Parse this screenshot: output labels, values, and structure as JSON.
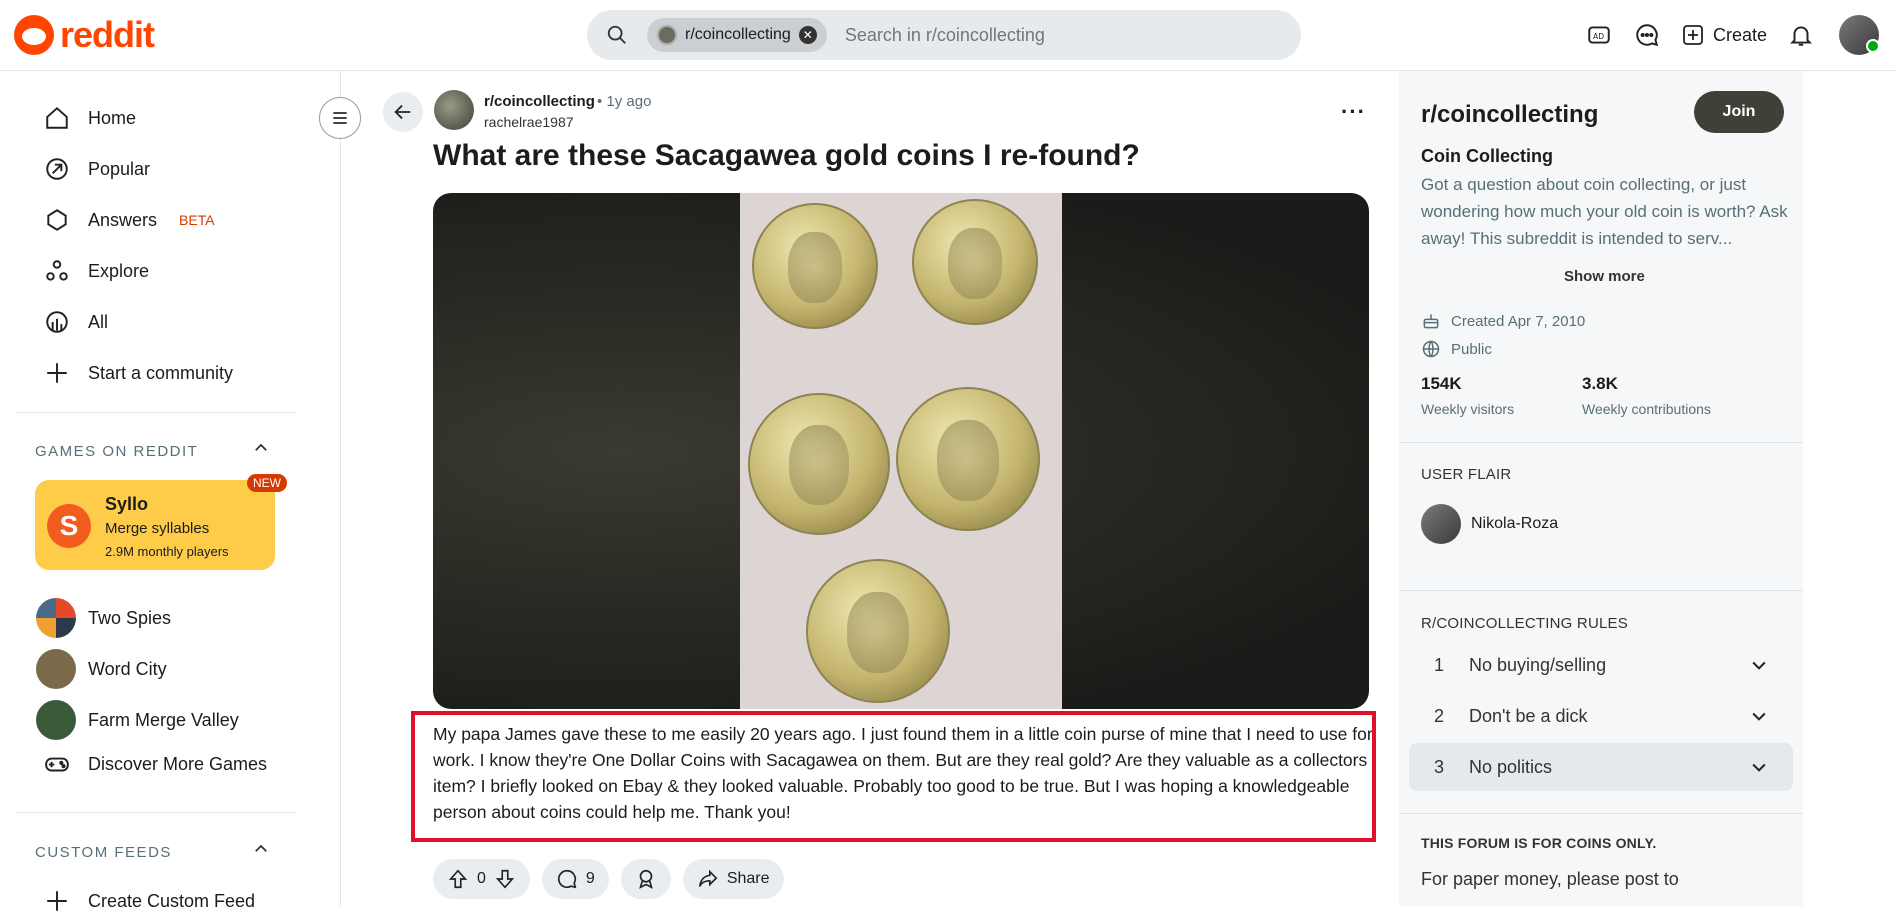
{
  "header": {
    "logo_text": "reddit",
    "search_chip": "r/coincollecting",
    "search_placeholder": "Search in r/coincollecting",
    "create_label": "Create"
  },
  "leftnav": {
    "items": [
      {
        "label": "Home",
        "icon": "home-icon"
      },
      {
        "label": "Popular",
        "icon": "popular-icon"
      },
      {
        "label": "Answers",
        "badge": "BETA",
        "icon": "answers-icon"
      },
      {
        "label": "Explore",
        "icon": "explore-icon"
      },
      {
        "label": "All",
        "icon": "all-icon"
      },
      {
        "label": "Start a community",
        "icon": "plus-icon"
      }
    ],
    "games_title": "GAMES ON REDDIT",
    "featured_game": {
      "name": "Syllo",
      "subtitle": "Merge syllables",
      "players": "2.9M monthly players",
      "badge": "NEW"
    },
    "games": [
      "Two Spies",
      "Word City",
      "Farm Merge Valley",
      "Discover More Games"
    ],
    "custom_feeds_title": "CUSTOM FEEDS",
    "create_custom_feed": "Create Custom Feed"
  },
  "post": {
    "subreddit": "r/coincollecting",
    "time": "• 1y ago",
    "author": "rachelrae1987",
    "title": "What are these Sacagawea gold coins I re-found?",
    "body": "My papa James gave these to me easily 20 years ago. I just found them in a little coin purse of mine that I need to use for work. I know they're One Dollar Coins with Sacagawea on them. But are they real gold? Are they valuable as a collectors item? I briefly looked on Ebay & they looked valuable. Probably too good to be true. But I was hoping a knowledgeable person about coins could help me. Thank you!",
    "votes": "0",
    "comments": "9",
    "share_label": "Share"
  },
  "sidebar": {
    "title": "r/coincollecting",
    "join_label": "Join",
    "subtitle": "Coin Collecting",
    "description": "Got a question about coin collecting, or just wondering how much your old coin is worth? Ask away! This subreddit is intended to serv...",
    "show_more": "Show more",
    "created": "Created Apr 7, 2010",
    "visibility": "Public",
    "visitors_num": "154K",
    "visitors_lbl": "Weekly visitors",
    "contrib_num": "3.8K",
    "contrib_lbl": "Weekly contributions",
    "user_flair_title": "USER FLAIR",
    "flair_user": "Nikola-Roza",
    "rules_title": "R/COINCOLLECTING RULES",
    "rules": [
      {
        "num": "1",
        "text": "No buying/selling"
      },
      {
        "num": "2",
        "text": "Don't be a dick"
      },
      {
        "num": "3",
        "text": "No politics"
      }
    ],
    "forum_title": "THIS FORUM IS FOR COINS ONLY.",
    "forum_text": "For paper money, please post to"
  }
}
